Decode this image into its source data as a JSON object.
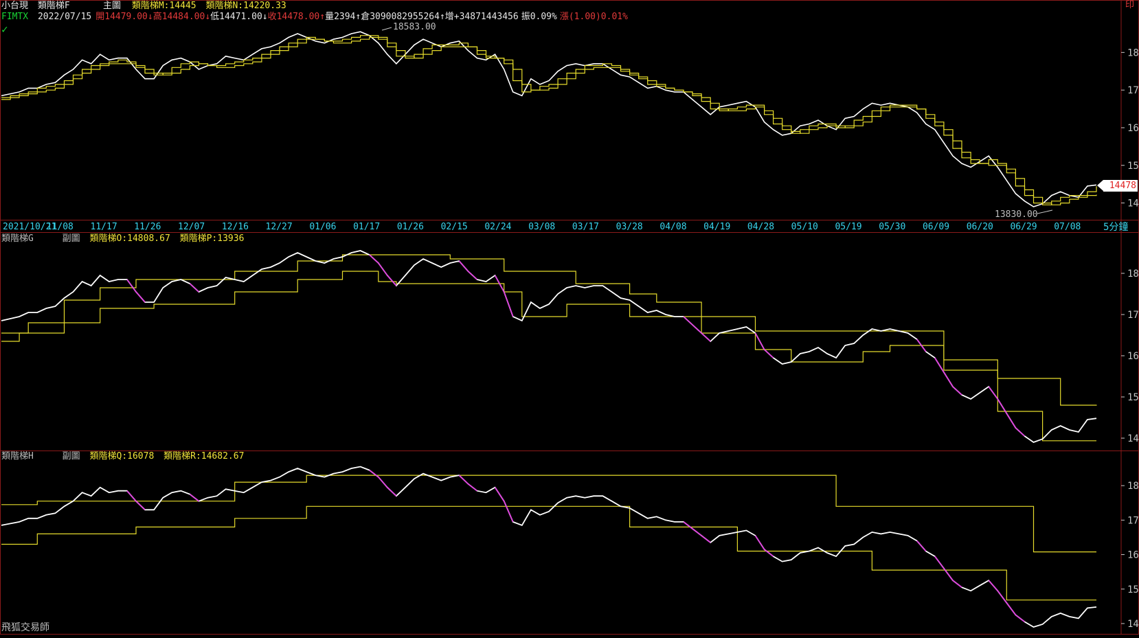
{
  "header": {
    "instrument": "小台現",
    "indicator_main": "類階梯F",
    "date": "2022/07/15",
    "open_label": "開14479.00",
    "high_label": "高14484.00",
    "low_label": "低14471.00",
    "close_label": "收14478.00",
    "volume_label": "量2394",
    "oi_label": "倉3090082955264",
    "increase_label": "增+34871443456",
    "amplitude_label": "振0.09%",
    "change_label": "漲(1.00)0.01%",
    "symbol": "FIMTX",
    "main_title": "主圖",
    "main_series_m": "類階梯M:14445",
    "main_series_n": "類階梯N:14220.33",
    "corner_label": "印"
  },
  "panel2": {
    "indicator": "類階梯G",
    "title": "副圖",
    "series_o": "類階梯O:14808.67",
    "series_p": "類階梯P:13936"
  },
  "panel3": {
    "indicator": "類階梯H",
    "title": "副圖",
    "series_q": "類階梯Q:16078",
    "series_r": "類階梯R:14682.67"
  },
  "footer": {
    "brand": "飛狐交易師"
  },
  "timeframe": "5分鐘",
  "last_price": "14478",
  "annotations": {
    "high_mark": "18583.00",
    "low_mark": "13830.00"
  },
  "x_labels": [
    "2021/10/21",
    "11/08",
    "11/17",
    "11/26",
    "12/07",
    "12/16",
    "12/27",
    "01/06",
    "01/17",
    "01/26",
    "02/15",
    "02/24",
    "03/08",
    "03/17",
    "03/28",
    "04/08",
    "04/19",
    "04/28",
    "05/10",
    "05/19",
    "05/30",
    "06/09",
    "06/20",
    "06/29",
    "07/08"
  ],
  "colors": {
    "background": "#000000",
    "price": "#ffffff",
    "price_down_seg": "#e040e0",
    "ladder": "#e6dc2c",
    "axis": "#c8c8c8",
    "border": "#8b1a1a",
    "x_axis_text": "#39d3ec"
  },
  "chart_data": [
    {
      "type": "line",
      "panel": "main",
      "ylim": [
        13700,
        18700
      ],
      "y_ticks": [
        "18000",
        "17000",
        "16000",
        "15000",
        "14000"
      ],
      "series": [
        {
          "name": "FIMTX",
          "values": [
            16850,
            16900,
            16950,
            17050,
            17050,
            17150,
            17200,
            17400,
            17550,
            17800,
            17700,
            17950,
            17800,
            17850,
            17850,
            17550,
            17300,
            17300,
            17650,
            17800,
            17850,
            17750,
            17550,
            17650,
            17700,
            17900,
            17850,
            17800,
            17950,
            18100,
            18150,
            18250,
            18400,
            18500,
            18400,
            18300,
            18250,
            18350,
            18400,
            18500,
            18550,
            18450,
            18250,
            17950,
            17700,
            17950,
            18200,
            18350,
            18250,
            18150,
            18250,
            18300,
            18050,
            17850,
            17800,
            17950,
            17550,
            16950,
            16850,
            17300,
            17150,
            17250,
            17500,
            17650,
            17700,
            17650,
            17700,
            17700,
            17550,
            17400,
            17350,
            17200,
            17050,
            17100,
            17000,
            16950,
            16950,
            16750,
            16550,
            16350,
            16550,
            16600,
            16650,
            16700,
            16550,
            16150,
            15950,
            15800,
            15850,
            16050,
            16100,
            16200,
            16050,
            15950,
            16250,
            16300,
            16500,
            16650,
            16600,
            16650,
            16600,
            16550,
            16400,
            16100,
            15950,
            15600,
            15250,
            15050,
            14950,
            15100,
            15250,
            14950,
            14600,
            14250,
            14050,
            13900,
            13980,
            14200,
            14300,
            14200,
            14150,
            14450,
            14480
          ]
        },
        {
          "name": "類階梯M",
          "values": [
            16800,
            16850,
            16900,
            16950,
            17050,
            17100,
            17150,
            17250,
            17400,
            17550,
            17650,
            17700,
            17750,
            17800,
            17750,
            17600,
            17450,
            17400,
            17450,
            17600,
            17700,
            17750,
            17700,
            17650,
            17650,
            17700,
            17750,
            17800,
            17850,
            17950,
            18050,
            18150,
            18250,
            18350,
            18400,
            18350,
            18300,
            18300,
            18350,
            18400,
            18450,
            18450,
            18350,
            18150,
            17900,
            17850,
            17950,
            18100,
            18200,
            18200,
            18200,
            18250,
            18150,
            17950,
            17850,
            17850,
            17700,
            17250,
            16950,
            17000,
            17100,
            17150,
            17300,
            17450,
            17550,
            17650,
            17650,
            17700,
            17650,
            17500,
            17400,
            17300,
            17150,
            17100,
            17050,
            17000,
            16950,
            16850,
            16700,
            16500,
            16450,
            16500,
            16550,
            16600,
            16600,
            16350,
            16100,
            15950,
            15850,
            15950,
            16050,
            16100,
            16100,
            16000,
            16050,
            16200,
            16300,
            16450,
            16550,
            16600,
            16600,
            16600,
            16500,
            16250,
            16050,
            15800,
            15450,
            15200,
            15050,
            15050,
            15150,
            15050,
            14800,
            14450,
            14200,
            14000,
            13950,
            14050,
            14150,
            14200,
            14200,
            14300,
            14445
          ]
        },
        {
          "name": "類階梯N",
          "values": [
            16750,
            16800,
            16850,
            16900,
            16950,
            17000,
            17050,
            17150,
            17300,
            17450,
            17550,
            17650,
            17700,
            17700,
            17700,
            17650,
            17550,
            17450,
            17400,
            17450,
            17550,
            17650,
            17700,
            17650,
            17600,
            17600,
            17650,
            17700,
            17750,
            17850,
            17950,
            18050,
            18150,
            18250,
            18350,
            18350,
            18300,
            18250,
            18250,
            18300,
            18350,
            18400,
            18400,
            18250,
            18050,
            17900,
            17850,
            17950,
            18050,
            18150,
            18150,
            18150,
            18150,
            18050,
            17900,
            17850,
            17800,
            17550,
            17150,
            17000,
            17000,
            17050,
            17150,
            17300,
            17450,
            17550,
            17600,
            17600,
            17600,
            17550,
            17450,
            17350,
            17250,
            17150,
            17050,
            17000,
            16950,
            16900,
            16800,
            16650,
            16500,
            16450,
            16450,
            16500,
            16550,
            16450,
            16250,
            16050,
            15900,
            15850,
            15950,
            16000,
            16050,
            16050,
            16000,
            16050,
            16150,
            16300,
            16450,
            16550,
            16550,
            16550,
            16500,
            16350,
            16150,
            15950,
            15650,
            15350,
            15150,
            15050,
            15000,
            15000,
            14900,
            14650,
            14350,
            14150,
            14000,
            13950,
            14000,
            14100,
            14150,
            14200,
            14220.33
          ]
        }
      ]
    },
    {
      "type": "line",
      "panel": "sub1",
      "ylim": [
        13800,
        18700
      ],
      "y_ticks": [
        "18000",
        "17000",
        "16000",
        "15000",
        "14000"
      ],
      "series": [
        {
          "name": "類階梯O",
          "values": [
            16550,
            16550,
            16550,
            16800,
            16800,
            16800,
            16800,
            17350,
            17350,
            17350,
            17350,
            17650,
            17650,
            17650,
            17650,
            17850,
            17850,
            17850,
            17850,
            17850,
            17850,
            17850,
            17850,
            17850,
            17850,
            17850,
            18050,
            18050,
            18050,
            18050,
            18050,
            18050,
            18050,
            18300,
            18300,
            18300,
            18300,
            18300,
            18450,
            18450,
            18450,
            18450,
            18450,
            18450,
            18450,
            18450,
            18450,
            18450,
            18450,
            18450,
            18350,
            18350,
            18350,
            18350,
            18350,
            18350,
            18050,
            18050,
            18050,
            18050,
            18050,
            18050,
            18050,
            18050,
            17750,
            17750,
            17750,
            17750,
            17750,
            17750,
            17500,
            17500,
            17500,
            17300,
            17300,
            17300,
            17300,
            17300,
            16950,
            16950,
            16950,
            16950,
            16950,
            16950,
            16600,
            16600,
            16600,
            16600,
            16600,
            16600,
            16600,
            16600,
            16600,
            16600,
            16600,
            16600,
            16600,
            16600,
            16600,
            16600,
            16600,
            16600,
            16600,
            16600,
            16600,
            15900,
            15900,
            15900,
            15900,
            15900,
            15900,
            15450,
            15450,
            15450,
            15450,
            15450,
            15450,
            15450,
            14800,
            14800,
            14800,
            14800,
            14808.67
          ]
        },
        {
          "name": "類階梯P",
          "values": [
            16350,
            16350,
            16550,
            16550,
            16550,
            16550,
            16550,
            16800,
            16800,
            16800,
            16800,
            17150,
            17150,
            17150,
            17150,
            17150,
            17150,
            17250,
            17250,
            17250,
            17250,
            17250,
            17250,
            17250,
            17250,
            17250,
            17550,
            17550,
            17550,
            17550,
            17550,
            17550,
            17550,
            17850,
            17850,
            17850,
            17850,
            17850,
            18050,
            18050,
            18050,
            18050,
            17800,
            17800,
            17750,
            17750,
            17750,
            17750,
            17750,
            17750,
            17750,
            17750,
            17750,
            17750,
            17750,
            17750,
            17550,
            17550,
            16950,
            16950,
            16950,
            16950,
            16950,
            17250,
            17250,
            17250,
            17250,
            17250,
            17250,
            17250,
            16950,
            16950,
            16950,
            16950,
            16950,
            16950,
            16950,
            16950,
            16550,
            16550,
            16550,
            16550,
            16550,
            16550,
            16150,
            16150,
            16150,
            16150,
            15850,
            15850,
            15850,
            15850,
            15850,
            15850,
            15850,
            15850,
            16100,
            16100,
            16100,
            16250,
            16250,
            16250,
            16250,
            16250,
            16250,
            15650,
            15650,
            15650,
            15650,
            15650,
            15650,
            14650,
            14650,
            14650,
            14650,
            14650,
            13936,
            13936,
            13936,
            13936,
            13936,
            13936,
            13936
          ]
        }
      ]
    },
    {
      "type": "line",
      "panel": "sub2",
      "ylim": [
        13800,
        18700
      ],
      "y_ticks": [
        "18000",
        "17000",
        "16000",
        "15000",
        "14000"
      ],
      "series": [
        {
          "name": "類階梯Q",
          "values": [
            17450,
            17450,
            17450,
            17450,
            17550,
            17550,
            17550,
            17550,
            17550,
            17550,
            17550,
            17550,
            17550,
            17550,
            17550,
            17550,
            17550,
            17550,
            17550,
            17550,
            17550,
            17550,
            17550,
            17550,
            17550,
            17550,
            18100,
            18100,
            18100,
            18100,
            18100,
            18100,
            18100,
            18100,
            18300,
            18300,
            18300,
            18300,
            18300,
            18300,
            18300,
            18300,
            18300,
            18300,
            18300,
            18300,
            18300,
            18300,
            18300,
            18300,
            18300,
            18300,
            18300,
            18300,
            18300,
            18300,
            18300,
            18300,
            18300,
            18300,
            18300,
            18300,
            18300,
            18300,
            18300,
            18300,
            18300,
            18300,
            18300,
            18300,
            18300,
            18300,
            18300,
            18300,
            18300,
            18300,
            18300,
            18300,
            18300,
            18300,
            18300,
            18300,
            18300,
            18300,
            18300,
            18300,
            18300,
            18300,
            18300,
            18300,
            18300,
            18300,
            18300,
            17400,
            17400,
            17400,
            17400,
            17400,
            17400,
            17400,
            17400,
            17400,
            17400,
            17400,
            17400,
            17400,
            17400,
            17400,
            17400,
            17400,
            17400,
            17400,
            17400,
            17400,
            17400,
            16078,
            16078,
            16078,
            16078,
            16078,
            16078,
            16078,
            16078
          ]
        },
        {
          "name": "類階梯R",
          "values": [
            16300,
            16300,
            16300,
            16300,
            16600,
            16600,
            16600,
            16600,
            16600,
            16600,
            16600,
            16600,
            16600,
            16600,
            16600,
            16800,
            16800,
            16800,
            16800,
            16800,
            16800,
            16800,
            16800,
            16800,
            16800,
            16800,
            17050,
            17050,
            17050,
            17050,
            17050,
            17050,
            17050,
            17050,
            17400,
            17400,
            17400,
            17400,
            17400,
            17400,
            17400,
            17400,
            17400,
            17400,
            17400,
            17400,
            17400,
            17400,
            17400,
            17400,
            17400,
            17400,
            17400,
            17400,
            17400,
            17400,
            17400,
            17400,
            17400,
            17400,
            17400,
            17400,
            17400,
            17400,
            17400,
            17400,
            17400,
            17400,
            17400,
            17400,
            16800,
            16800,
            16800,
            16800,
            16800,
            16800,
            16800,
            16800,
            16800,
            16800,
            16800,
            16800,
            16100,
            16100,
            16100,
            16100,
            16100,
            16100,
            16100,
            16100,
            16100,
            16100,
            16100,
            16100,
            16100,
            16100,
            16100,
            15550,
            15550,
            15550,
            15550,
            15550,
            15550,
            15550,
            15550,
            15550,
            15550,
            15550,
            15550,
            15550,
            15550,
            15550,
            14682.67,
            14682.67,
            14682.67,
            14682.67,
            14682.67,
            14682.67,
            14682.67,
            14682.67,
            14682.67,
            14682.67,
            14682.67
          ]
        }
      ]
    }
  ]
}
